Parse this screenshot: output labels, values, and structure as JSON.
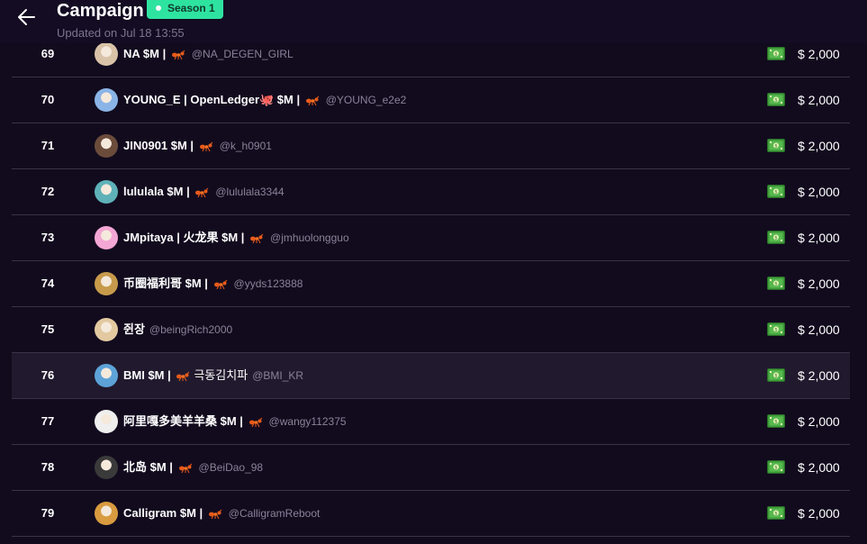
{
  "header": {
    "title": "Campaign",
    "badge": "Season 1",
    "updated": "Updated on Jul 18 13:55",
    "back_icon": "arrow-left-icon",
    "badge_color": "#2ee3a0"
  },
  "rows": [
    {
      "rank": "69",
      "name": "NA $M |",
      "suffix": "",
      "handle": "@NA_DEGEN_GIRL",
      "amount": "$ 2,000",
      "avatar_color": "#d9c3a8",
      "ant": true
    },
    {
      "rank": "70",
      "name": "YOUNG_E | OpenLedger🐙 $M |",
      "suffix": "",
      "handle": "@YOUNG_e2e2",
      "amount": "$ 2,000",
      "avatar_color": "#8ab4e6",
      "ant": true
    },
    {
      "rank": "71",
      "name": "JIN0901 $M |",
      "suffix": "",
      "handle": "@k_h0901",
      "amount": "$ 2,000",
      "avatar_color": "#6b4c3b",
      "ant": true
    },
    {
      "rank": "72",
      "name": "lululala $M |",
      "suffix": "",
      "handle": "@lululala3344",
      "amount": "$ 2,000",
      "avatar_color": "#5fb1b8",
      "ant": true
    },
    {
      "rank": "73",
      "name": "JMpitaya | 火龙果 $M |",
      "suffix": "",
      "handle": "@jmhuolongguo",
      "amount": "$ 2,000",
      "avatar_color": "#f4a6d4",
      "ant": true
    },
    {
      "rank": "74",
      "name": "币圈福利哥 $M |",
      "suffix": "",
      "handle": "@yyds123888",
      "amount": "$ 2,000",
      "avatar_color": "#c79a4b",
      "ant": true
    },
    {
      "rank": "75",
      "name": "쥔장",
      "suffix": "",
      "handle": "@beingRich2000",
      "amount": "$ 2,000",
      "avatar_color": "#e2c9a0",
      "ant": false
    },
    {
      "rank": "76",
      "name": "BMI $M |",
      "suffix": "극동김치파",
      "handle": "@BMI_KR",
      "amount": "$ 2,000",
      "avatar_color": "#5da3d8",
      "ant": true
    },
    {
      "rank": "77",
      "name": "阿里嘎多美羊羊桑 $M |",
      "suffix": "",
      "handle": "@wangy112375",
      "amount": "$ 2,000",
      "avatar_color": "#efefef",
      "ant": true
    },
    {
      "rank": "78",
      "name": "北岛 $M |",
      "suffix": "",
      "handle": "@BeiDao_98",
      "amount": "$ 2,000",
      "avatar_color": "#3a3a3a",
      "ant": true
    },
    {
      "rank": "79",
      "name": "Calligram $M |",
      "suffix": "",
      "handle": "@CalligramReboot",
      "amount": "$ 2,000",
      "avatar_color": "#d99b3f",
      "ant": true
    }
  ],
  "icons": {
    "ant": "ant-icon",
    "cash": "cash-icon"
  }
}
